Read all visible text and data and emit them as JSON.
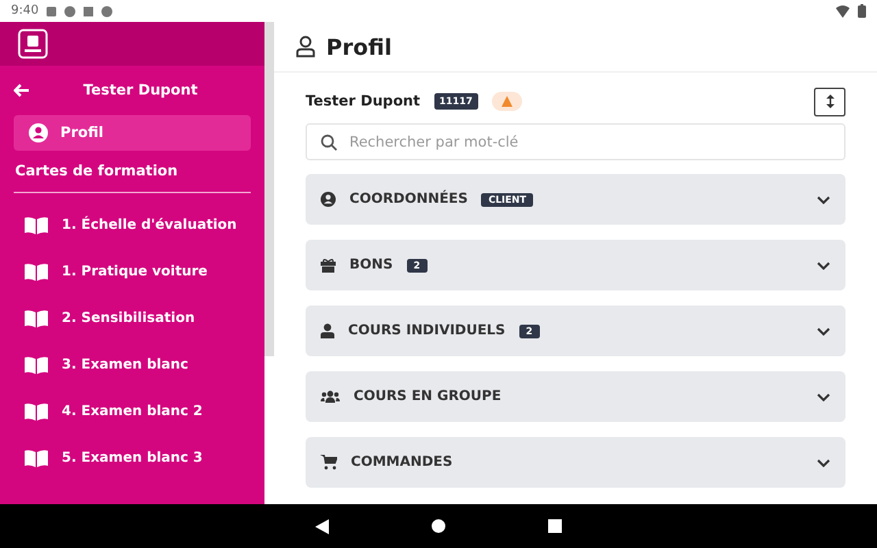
{
  "status_bar": {
    "time": "9:40"
  },
  "sidebar": {
    "user": "Tester Dupont",
    "profile": {
      "label": "Profil",
      "selected": true
    },
    "section_title": "Cartes de formation",
    "items": [
      {
        "label": "1. Échelle d'évaluation"
      },
      {
        "label": "1. Pratique voiture"
      },
      {
        "label": "2. Sensibilisation"
      },
      {
        "label": "3. Examen blanc"
      },
      {
        "label": "4. Examen blanc 2"
      },
      {
        "label": "5. Examen blanc 3"
      }
    ]
  },
  "page": {
    "title": "Profil",
    "user": "Tester Dupont",
    "user_id": "11117",
    "search": {
      "placeholder": "Rechercher par mot-clé"
    },
    "sections": [
      {
        "label": "COORDONNÉES",
        "badge": "CLIENT",
        "expanded": false
      },
      {
        "label": "BONS",
        "badge": "2",
        "expanded": false
      },
      {
        "label": "COURS INDIVIDUELS",
        "badge": "2",
        "expanded": false
      },
      {
        "label": "COURS EN GROUPE",
        "expanded": false
      },
      {
        "label": "COMMANDES",
        "expanded": false
      }
    ]
  }
}
